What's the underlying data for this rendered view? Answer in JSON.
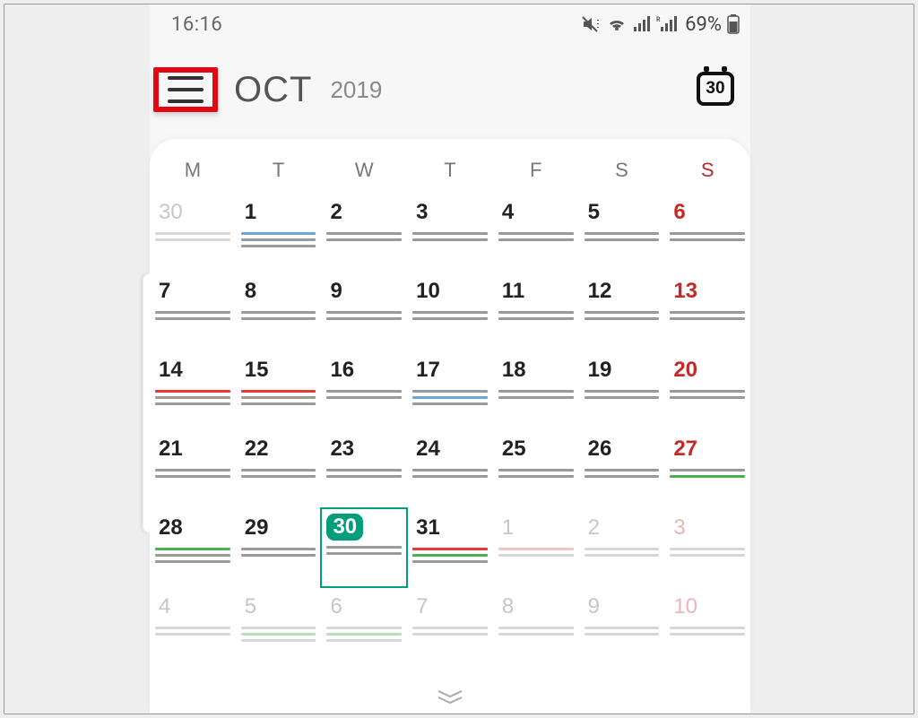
{
  "status": {
    "time": "16:16",
    "battery": "69%"
  },
  "header": {
    "month": "OCT",
    "year": "2019",
    "today_badge": "30"
  },
  "dow": [
    "M",
    "T",
    "W",
    "T",
    "F",
    "S",
    "S"
  ],
  "colors": {
    "g": "#9a9a9a",
    "r": "#e53935",
    "b": "#6aa6d6",
    "gr": "#4caf50",
    "lg": "#d6d6d6",
    "lr": "#f2c3c3",
    "lgr": "#b6e2b6"
  },
  "weeks": [
    [
      {
        "n": "30",
        "faded": true,
        "ev": [
          "lg",
          "lg"
        ]
      },
      {
        "n": "1",
        "ev": [
          "b",
          "g",
          "g"
        ]
      },
      {
        "n": "2",
        "ev": [
          "g",
          "g"
        ]
      },
      {
        "n": "3",
        "ev": [
          "g",
          "g"
        ]
      },
      {
        "n": "4",
        "ev": [
          "g",
          "g"
        ]
      },
      {
        "n": "5",
        "ev": [
          "g",
          "g"
        ]
      },
      {
        "n": "6",
        "sun": true,
        "ev": [
          "g",
          "g"
        ]
      }
    ],
    [
      {
        "n": "7",
        "ev": [
          "g",
          "g"
        ]
      },
      {
        "n": "8",
        "ev": [
          "g",
          "g"
        ]
      },
      {
        "n": "9",
        "ev": [
          "g",
          "g"
        ]
      },
      {
        "n": "10",
        "ev": [
          "g",
          "g"
        ]
      },
      {
        "n": "11",
        "ev": [
          "g",
          "g"
        ]
      },
      {
        "n": "12",
        "ev": [
          "g",
          "g"
        ]
      },
      {
        "n": "13",
        "sun": true,
        "ev": [
          "g",
          "g"
        ]
      }
    ],
    [
      {
        "n": "14",
        "ev": [
          "r",
          "g",
          "g"
        ]
      },
      {
        "n": "15",
        "ev": [
          "r",
          "g",
          "g"
        ]
      },
      {
        "n": "16",
        "ev": [
          "g",
          "g"
        ]
      },
      {
        "n": "17",
        "ev": [
          "g",
          "b",
          "g"
        ]
      },
      {
        "n": "18",
        "ev": [
          "g",
          "g"
        ]
      },
      {
        "n": "19",
        "ev": [
          "g",
          "g"
        ]
      },
      {
        "n": "20",
        "sun": true,
        "ev": [
          "g",
          "g"
        ]
      }
    ],
    [
      {
        "n": "21",
        "ev": [
          "g",
          "g"
        ]
      },
      {
        "n": "22",
        "ev": [
          "g",
          "g"
        ]
      },
      {
        "n": "23",
        "ev": [
          "g",
          "g"
        ]
      },
      {
        "n": "24",
        "ev": [
          "g",
          "g"
        ]
      },
      {
        "n": "25",
        "ev": [
          "g",
          "g"
        ]
      },
      {
        "n": "26",
        "ev": [
          "g",
          "g"
        ]
      },
      {
        "n": "27",
        "sun": true,
        "ev": [
          "g",
          "gr"
        ]
      }
    ],
    [
      {
        "n": "28",
        "ev": [
          "gr",
          "g",
          "g"
        ]
      },
      {
        "n": "29",
        "ev": [
          "g",
          "g"
        ]
      },
      {
        "n": "30",
        "today": true,
        "selected": true,
        "ev": [
          "g",
          "g"
        ]
      },
      {
        "n": "31",
        "ev": [
          "r",
          "gr",
          "g"
        ]
      },
      {
        "n": "1",
        "faded": true,
        "ev": [
          "lr",
          "lg"
        ]
      },
      {
        "n": "2",
        "faded": true,
        "ev": [
          "lg",
          "lg"
        ]
      },
      {
        "n": "3",
        "faded": true,
        "sun": true,
        "ev": [
          "lg",
          "lg"
        ]
      }
    ],
    [
      {
        "n": "4",
        "faded": true,
        "ev": [
          "lg",
          "lg"
        ]
      },
      {
        "n": "5",
        "faded": true,
        "ev": [
          "lg",
          "lgr",
          "lg"
        ]
      },
      {
        "n": "6",
        "faded": true,
        "ev": [
          "lg",
          "lgr",
          "lg"
        ]
      },
      {
        "n": "7",
        "faded": true,
        "ev": [
          "lg",
          "lg"
        ]
      },
      {
        "n": "8",
        "faded": true,
        "ev": [
          "lg",
          "lg"
        ]
      },
      {
        "n": "9",
        "faded": true,
        "ev": [
          "lg",
          "lg"
        ]
      },
      {
        "n": "10",
        "faded": true,
        "sun": true,
        "ev": [
          "lg",
          "lg"
        ]
      }
    ]
  ]
}
